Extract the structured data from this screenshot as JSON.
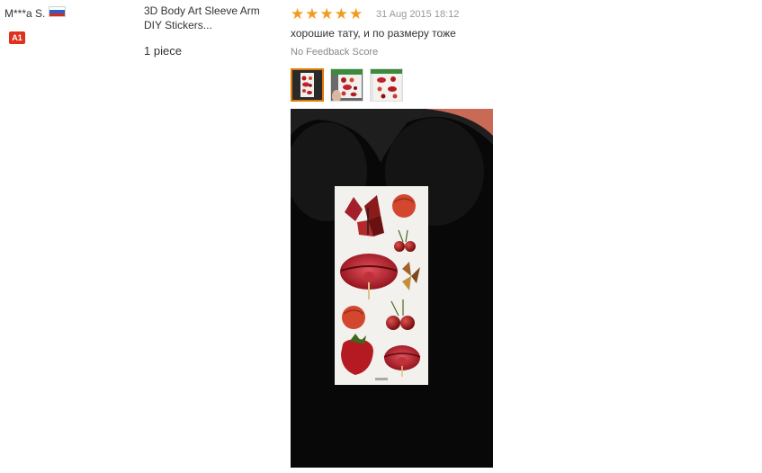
{
  "reviewer": {
    "name": "M***a S.",
    "country_flag": "russia-flag-icon",
    "flag_colors": [
      "#ffffff",
      "#2d5fc8",
      "#d52b1e"
    ],
    "level_badge": "A1",
    "badge_color": "#e0311e"
  },
  "product": {
    "name": "3D Body Art Sleeve Arm DIY Stickers...",
    "quantity": "1 piece"
  },
  "review": {
    "rating": 5,
    "rating_max": 5,
    "date": "31 Aug 2015 18:12",
    "text": "хорошие тату, и по размеру тоже",
    "feedback_score": "No Feedback Score",
    "star_color": "#f29c1e"
  },
  "photos": {
    "thumbnail_count": 3,
    "selected_index": 0,
    "accent_color": "#e07a00"
  }
}
